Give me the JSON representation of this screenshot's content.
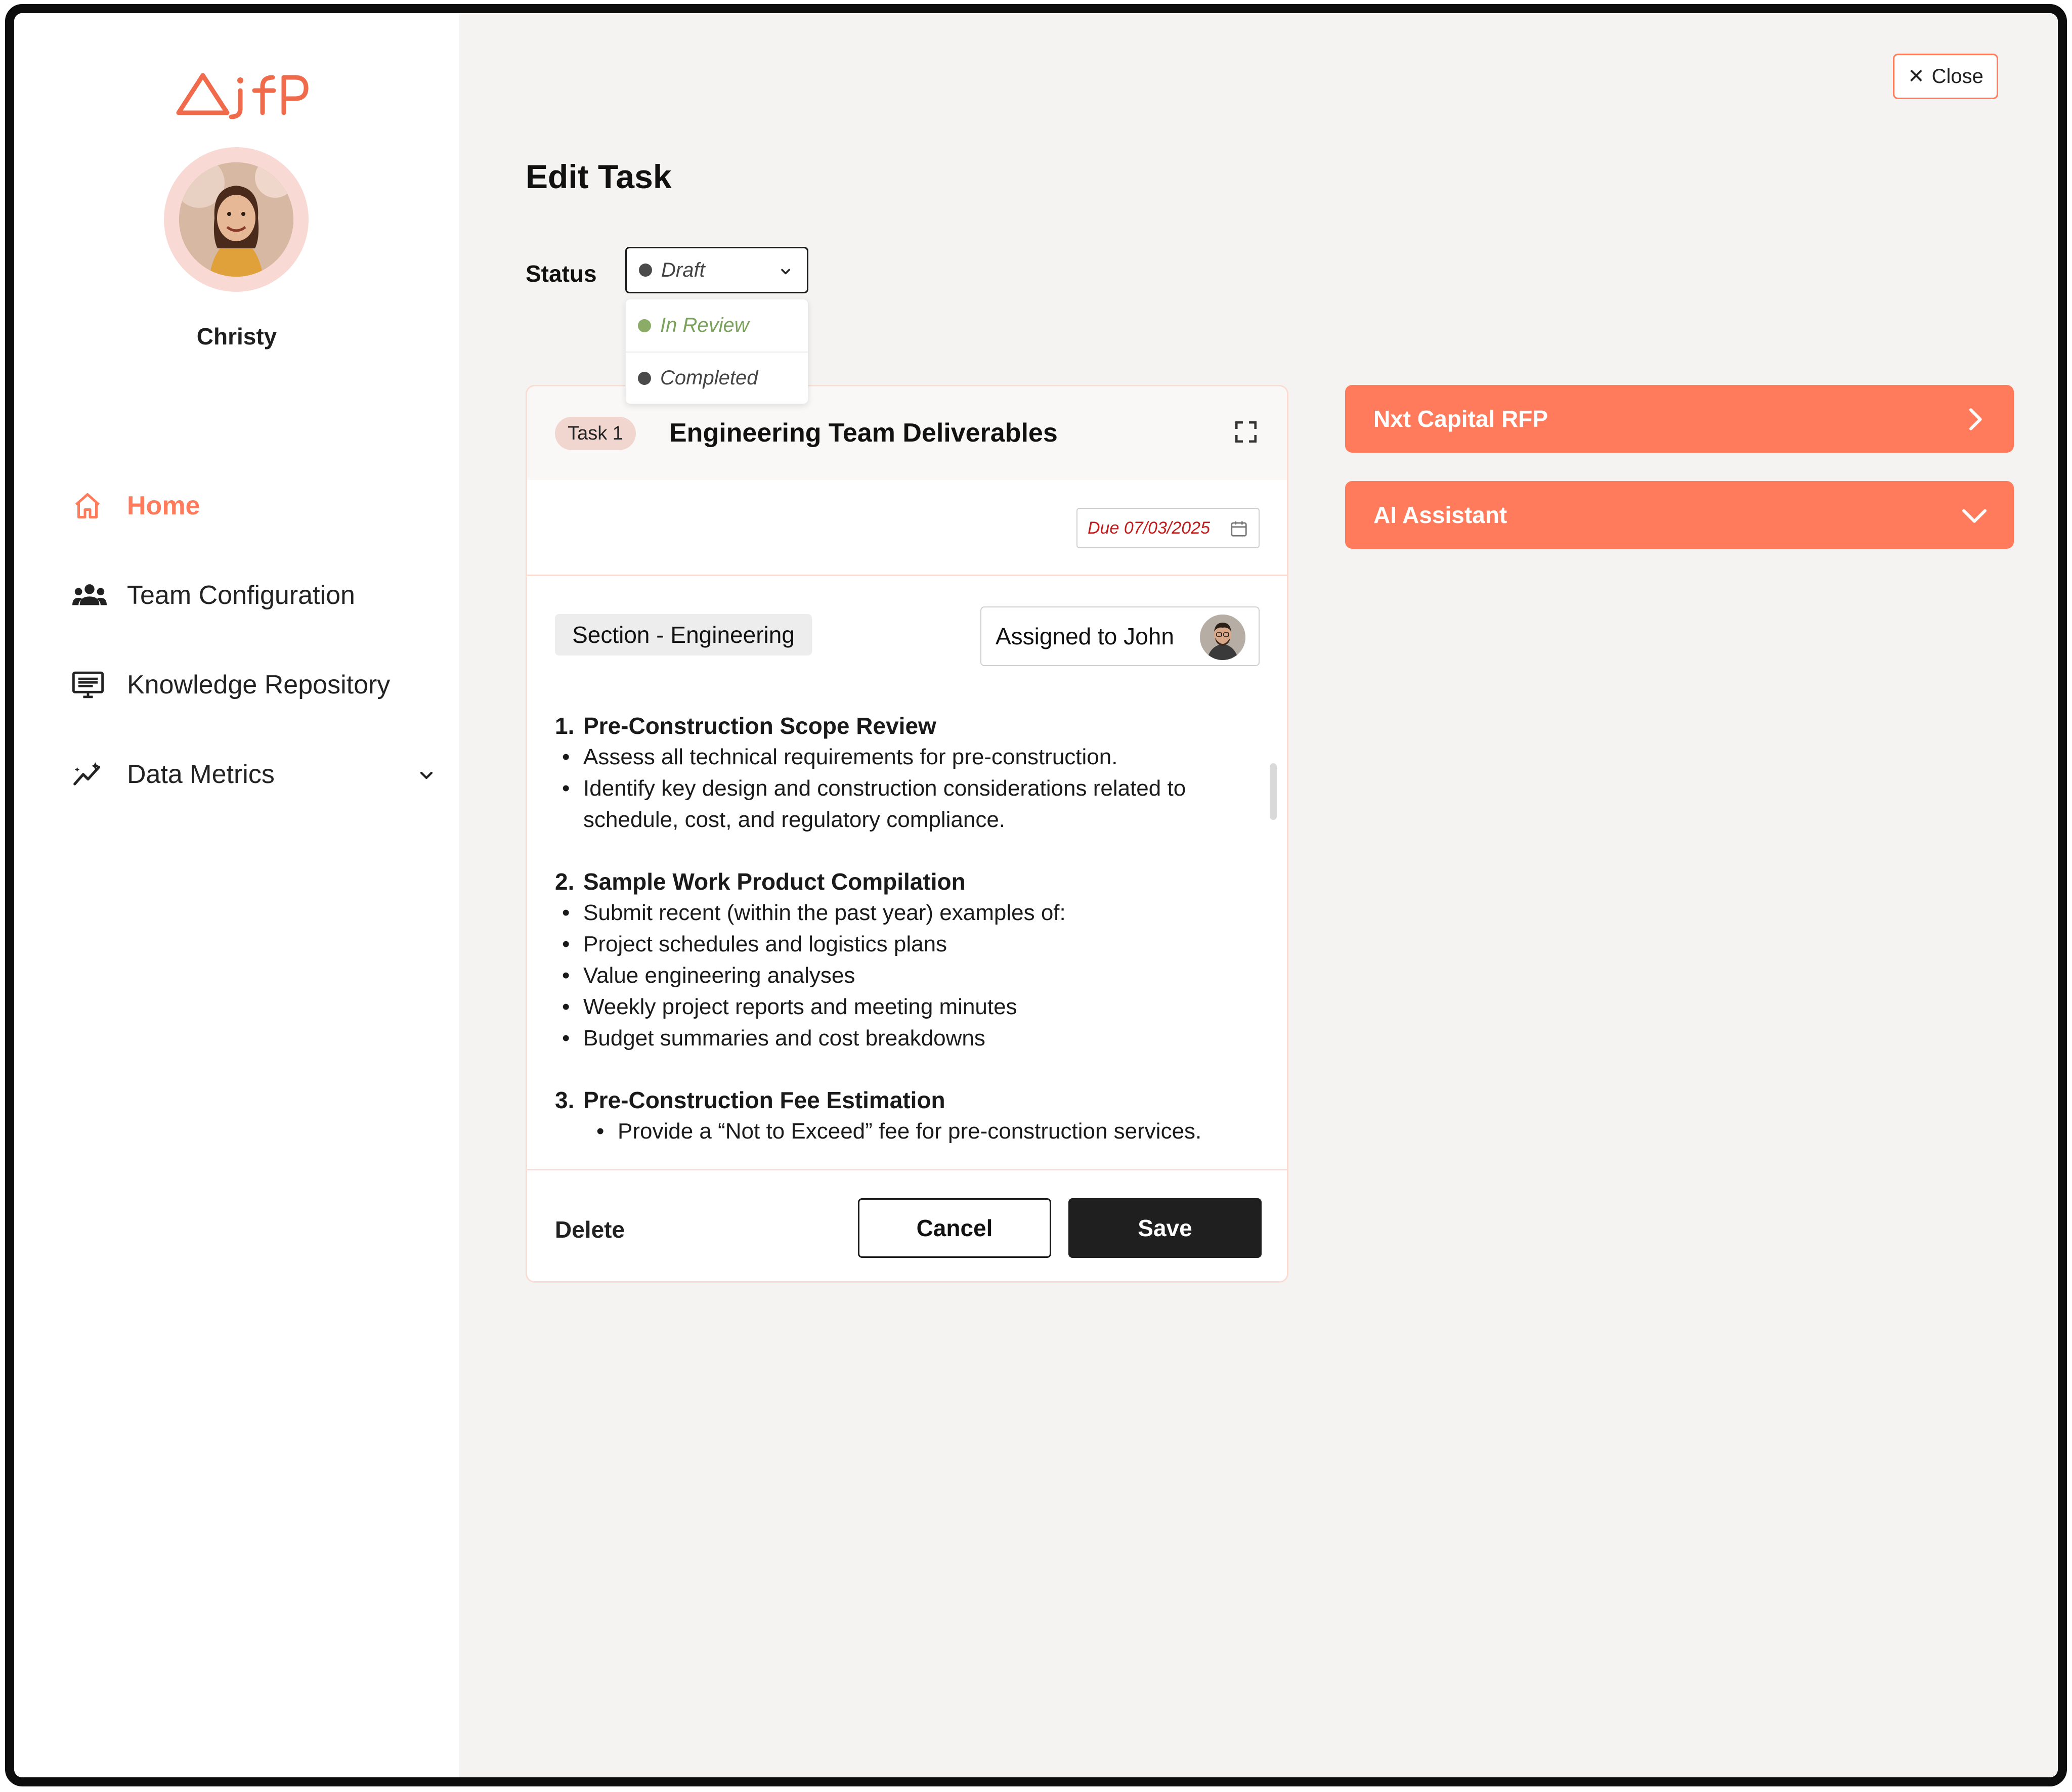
{
  "app": {
    "logo_text": "AifP",
    "user": {
      "name": "Christy"
    },
    "nav": [
      {
        "label": "Home",
        "icon": "home-icon",
        "active": true
      },
      {
        "label": "Team Configuration",
        "icon": "team-icon",
        "active": false
      },
      {
        "label": "Knowledge Repository",
        "icon": "repository-icon",
        "active": false
      },
      {
        "label": "Data Metrics",
        "icon": "metrics-icon",
        "active": false,
        "expandable": true
      }
    ]
  },
  "header": {
    "close_label": "Close",
    "title": "Edit Task"
  },
  "status": {
    "label": "Status",
    "selected": "Draft",
    "options": [
      {
        "label": "In Review",
        "color": "#8aac66"
      },
      {
        "label": "Completed",
        "color": "#4a4a4a"
      }
    ]
  },
  "task": {
    "number": "Task 1",
    "title": "Engineering Team Deliverables",
    "due": "Due 07/03/2025",
    "section": "Section - Engineering",
    "assigned": "Assigned to John",
    "items": [
      {
        "num": "1.",
        "heading": "Pre-Construction Scope Review",
        "bullets": [
          "Assess all technical requirements for pre-construction.",
          "Identify key design and construction considerations related to schedule, cost, and regulatory compliance."
        ]
      },
      {
        "num": "2.",
        "heading": "Sample Work Product Compilation",
        "bullets": [
          "Submit recent (within the past year) examples of:",
          "Project schedules and logistics plans",
          "Value engineering analyses",
          "Weekly project reports and meeting minutes",
          "Budget summaries and cost breakdowns"
        ]
      },
      {
        "num": "3.",
        "heading": "Pre-Construction Fee Estimation",
        "bullets": [
          "Provide a “Not to Exceed” fee for pre-construction services."
        ]
      }
    ],
    "actions": {
      "delete": "Delete",
      "cancel": "Cancel",
      "save": "Save"
    }
  },
  "side_panels": [
    {
      "label": "Nxt Capital RFP",
      "icon": "chevron-right-icon"
    },
    {
      "label": "AI Assistant",
      "icon": "chevron-down-icon"
    }
  ],
  "colors": {
    "accent": "#ff7b5c",
    "due_text": "#c21b1b",
    "review_green": "#8aac66",
    "dark": "#1f1f1f"
  }
}
